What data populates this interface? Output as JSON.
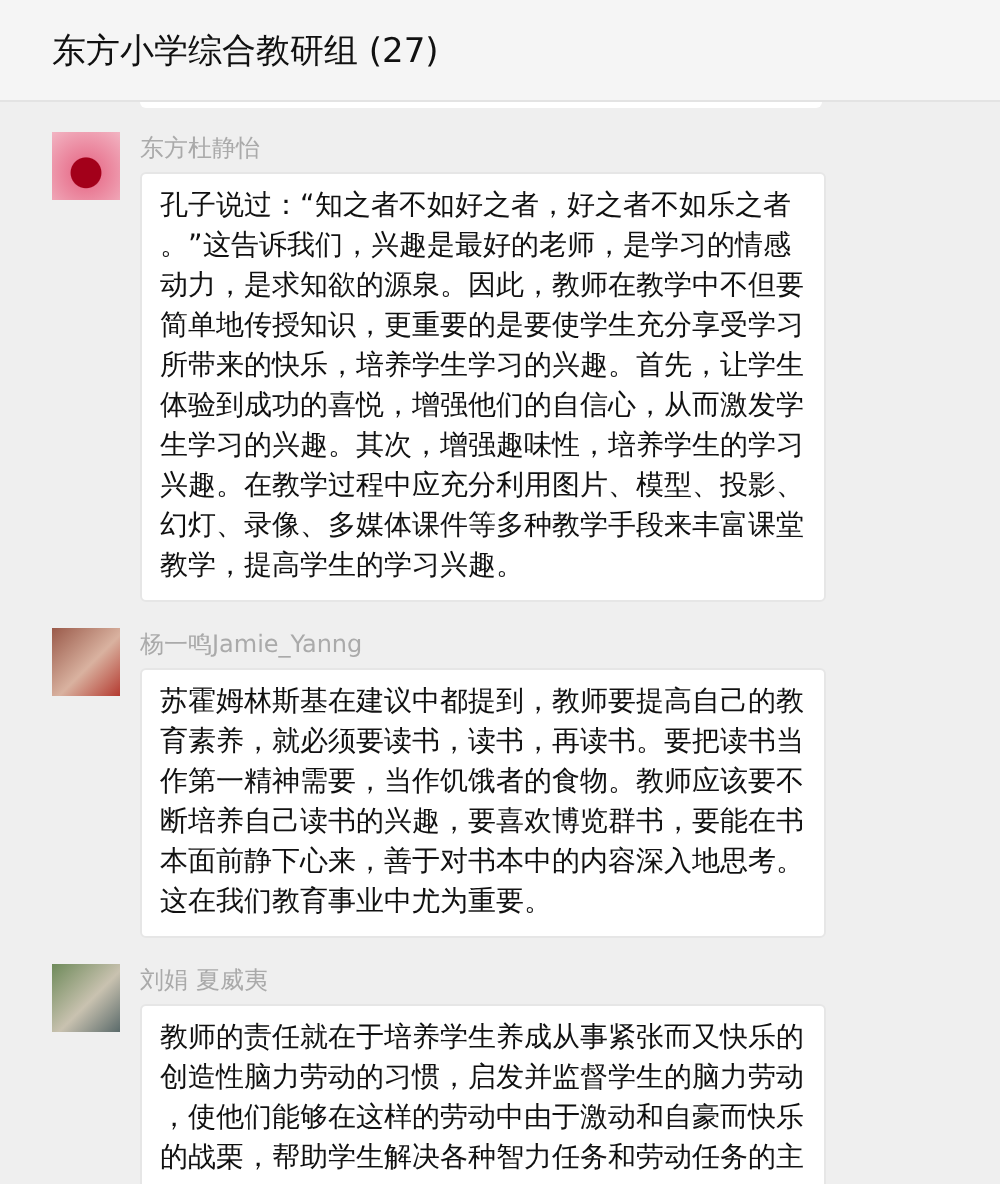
{
  "window": {
    "title": "东方小学综合教研组 (27)"
  },
  "messages": [
    {
      "sender": "东方杜静怡",
      "text": "孔子说过：“知之者不如好之者，好之者不如乐之者。”这告诉我们，兴趣是最好的老师，是学习的情感动力，是求知欲的源泉。因此，教师在教学中不但要简单地传授知识，更重要的是要使学生充分享受学习所带来的快乐，培养学生学习的兴趣。首先，让学生体验到成功的喜悦，增强他们的自信心，从而激发学生学习的兴趣。其次，增强趣味性，培养学生的学习兴趣。在教学过程中应充分利用图片、模型、投影、幻灯、录像、多媒体课件等多种教学手段来丰富课堂教学，提高学生的学习兴趣。"
    },
    {
      "sender": "杨一鸣Jamie_Yanng",
      "text": "苏霍姆林斯基在建议中都提到，教师要提高自己的教育素养，就必须要读书，读书，再读书。要把读书当作第一精神需要，当作饥饿者的食物。教师应该要不断培养自己读书的兴趣，要喜欢博览群书，要能在书本面前静下心来，善于对书本中的内容深入地思考。这在我们教育事业中尤为重要。"
    },
    {
      "sender": "刘娟 夏威夷",
      "text": "教师的责任就在于培养学生养成从事紧张而又快乐的创造性脑力劳动的习惯，启发并监督学生的脑力劳动，使他们能够在这样的劳动中由于激动和自豪而快乐的战栗，帮助学生解决各种智力任务和劳动任务的主"
    }
  ]
}
